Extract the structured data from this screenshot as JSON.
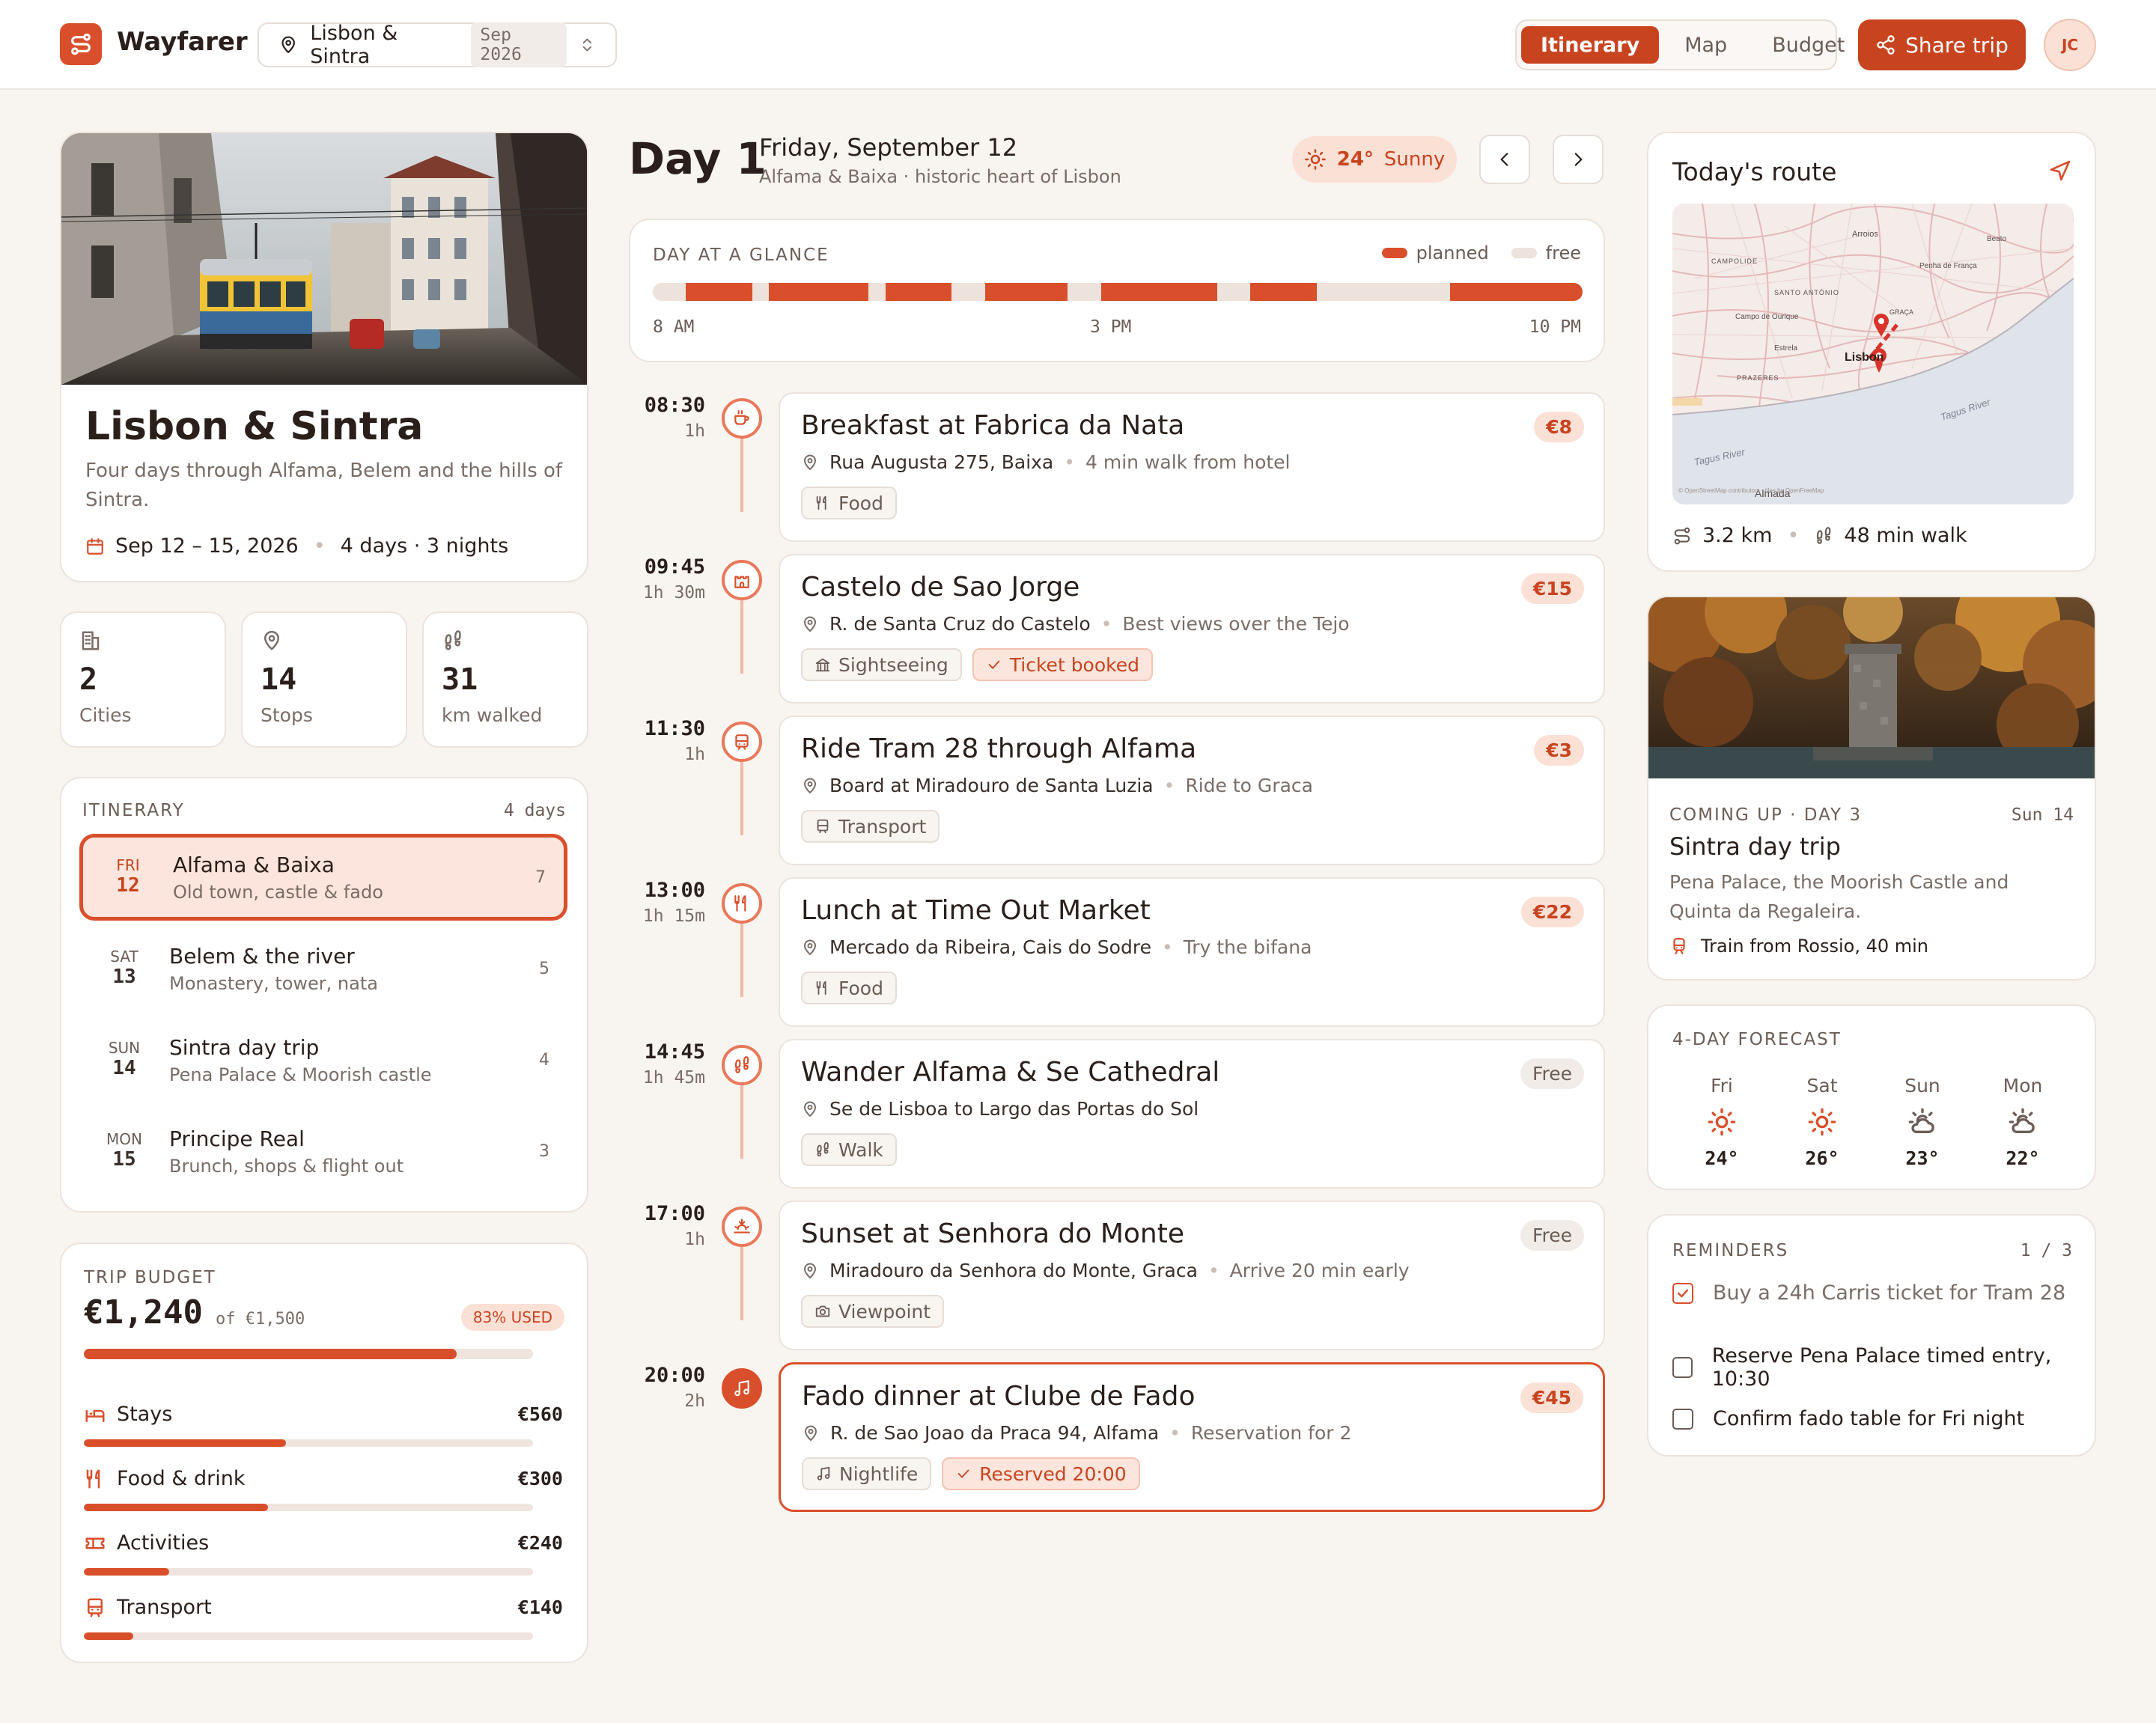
{
  "header": {
    "brand": "Wayfarer",
    "trip_selector": {
      "trip": "Lisbon & Sintra",
      "date": "Sep 2026"
    },
    "tabs": [
      {
        "label": "Itinerary",
        "active": true
      },
      {
        "label": "Map",
        "active": false
      },
      {
        "label": "Budget",
        "active": false
      }
    ],
    "share_label": "Share trip",
    "avatar_initials": "JC"
  },
  "colors": {
    "accent": "#d94f2b",
    "accent_dark": "#c8441f",
    "background": "#f8f4f0"
  },
  "trip": {
    "title": "Lisbon & Sintra",
    "description": "Four days through Alfama, Belem and the hills of Sintra.",
    "dates": "Sep 12 – 15, 2026",
    "duration": "4 days · 3 nights"
  },
  "stats": [
    {
      "icon": "building-icon",
      "value": "2",
      "label": "Cities"
    },
    {
      "icon": "pin-icon",
      "value": "14",
      "label": "Stops"
    },
    {
      "icon": "footprints-icon",
      "value": "31",
      "label": "km walked"
    }
  ],
  "itinerary": {
    "title": "ITINERARY",
    "count": "4 days",
    "days": [
      {
        "dow": "FRI",
        "date": "12",
        "title": "Alfama & Baixa",
        "subtitle": "Old town, castle & fado",
        "stops": "7",
        "active": true
      },
      {
        "dow": "SAT",
        "date": "13",
        "title": "Belem & the river",
        "subtitle": "Monastery, tower, nata",
        "stops": "5",
        "active": false
      },
      {
        "dow": "SUN",
        "date": "14",
        "title": "Sintra day trip",
        "subtitle": "Pena Palace & Moorish castle",
        "stops": "4",
        "active": false
      },
      {
        "dow": "MON",
        "date": "15",
        "title": "Principe Real",
        "subtitle": "Brunch, shops & flight out",
        "stops": "3",
        "active": false
      }
    ]
  },
  "budget": {
    "title": "TRIP BUDGET",
    "spent": "€1,240",
    "total": "of €1,500",
    "used_badge": "83% USED",
    "used_fraction": 0.83,
    "categories": [
      {
        "icon": "bed-icon",
        "label": "Stays",
        "amount": "€560",
        "fraction": 0.45
      },
      {
        "icon": "utensils-icon",
        "label": "Food & drink",
        "amount": "€300",
        "fraction": 0.41
      },
      {
        "icon": "ticket-icon",
        "label": "Activities",
        "amount": "€240",
        "fraction": 0.19
      },
      {
        "icon": "bus-icon",
        "label": "Transport",
        "amount": "€140",
        "fraction": 0.11
      }
    ]
  },
  "day": {
    "label": "Day 1",
    "date": "Friday, September 12",
    "subtitle": "Alfama & Baixa · historic heart of Lisbon",
    "weather": {
      "temp": "24°",
      "condition": "Sunny"
    },
    "glance": {
      "title": "DAY AT A GLANCE",
      "legend_planned": "planned",
      "legend_free": "free",
      "start_label": "8 AM",
      "mid_label": "3 PM",
      "end_label": "10 PM",
      "planned_segments": [
        [
          8.5,
          9.5
        ],
        [
          9.75,
          11.25
        ],
        [
          11.5,
          12.5
        ],
        [
          13.0,
          14.25
        ],
        [
          14.75,
          16.5
        ],
        [
          17.0,
          18.0
        ],
        [
          20.0,
          22.0
        ]
      ]
    }
  },
  "events": [
    {
      "time": "08:30",
      "duration": "1h",
      "icon": "coffee-icon",
      "title": "Breakfast at Fabrica da Nata",
      "price": "€8",
      "free": false,
      "location": "Rua Augusta 275, Baixa",
      "note": "4 min walk from hotel",
      "tags": [
        {
          "icon": "utensils-icon",
          "label": "Food"
        }
      ],
      "highlight": false
    },
    {
      "time": "09:45",
      "duration": "1h 30m",
      "icon": "castle-icon",
      "title": "Castelo de Sao Jorge",
      "price": "€15",
      "free": false,
      "location": "R. de Santa Cruz do Castelo",
      "note": "Best views over the Tejo",
      "tags": [
        {
          "icon": "landmark-icon",
          "label": "Sightseeing"
        },
        {
          "icon": "check-icon",
          "label": "Ticket booked",
          "ok": true
        }
      ],
      "highlight": false
    },
    {
      "time": "11:30",
      "duration": "1h",
      "icon": "tram-icon",
      "title": "Ride Tram 28 through Alfama",
      "price": "€3",
      "free": false,
      "location": "Board at Miradouro de Santa Luzia",
      "note": "Ride to Graca",
      "tags": [
        {
          "icon": "bus-icon",
          "label": "Transport"
        }
      ],
      "highlight": false
    },
    {
      "time": "13:00",
      "duration": "1h 15m",
      "icon": "utensils-icon",
      "title": "Lunch at Time Out Market",
      "price": "€22",
      "free": false,
      "location": "Mercado da Ribeira, Cais do Sodre",
      "note": "Try the bifana",
      "tags": [
        {
          "icon": "utensils-icon",
          "label": "Food"
        }
      ],
      "highlight": false
    },
    {
      "time": "14:45",
      "duration": "1h 45m",
      "icon": "footprints-icon",
      "title": "Wander Alfama & Se Cathedral",
      "price": "Free",
      "free": true,
      "location": "Se de Lisboa to Largo das Portas do Sol",
      "note": "",
      "tags": [
        {
          "icon": "footprints-icon",
          "label": "Walk"
        }
      ],
      "highlight": false
    },
    {
      "time": "17:00",
      "duration": "1h",
      "icon": "sunset-icon",
      "title": "Sunset at Senhora do Monte",
      "price": "Free",
      "free": true,
      "location": "Miradouro da Senhora do Monte, Graca",
      "note": "Arrive 20 min early",
      "tags": [
        {
          "icon": "camera-icon",
          "label": "Viewpoint"
        }
      ],
      "highlight": false
    },
    {
      "time": "20:00",
      "duration": "2h",
      "icon": "music-icon",
      "title": "Fado dinner at Clube de Fado",
      "price": "€45",
      "free": false,
      "location": "R. de Sao Joao da Praca 94, Alfama",
      "note": "Reservation for 2",
      "tags": [
        {
          "icon": "music-icon",
          "label": "Nightlife"
        },
        {
          "icon": "check-icon",
          "label": "Reserved 20:00",
          "ok": true
        }
      ],
      "highlight": true
    }
  ],
  "route": {
    "title": "Today's route",
    "distance": "3.2 km",
    "walk": "48 min walk",
    "map_labels": {
      "arroios": "Arroios",
      "beato": "Beato",
      "penha": "Penha de França",
      "campolide": "CAMPOLIDE",
      "santo_antonio": "SANTO ANTÓNIO",
      "campo_ourique": "Campo de Ourique",
      "estrela": "Estrela",
      "graca": "GRAÇA",
      "lisbon": "Lisbon",
      "prazeres": "PRAZERES",
      "tagus1": "Tagus River",
      "tagus2": "Tagus River",
      "almada": "Almada",
      "attribution": "© OpenStreetMap contributors · tiles by OpenFreeMap"
    }
  },
  "coming_up": {
    "label": "COMING UP · DAY 3",
    "date": "Sun 14",
    "title": "Sintra day trip",
    "description": "Pena Palace, the Moorish Castle and Quinta da Regaleira.",
    "transport": "Train from Rossio, 40 min"
  },
  "forecast": {
    "title": "4-DAY FORECAST",
    "days": [
      {
        "day": "Fri",
        "icon": "sun-icon",
        "temp": "24°"
      },
      {
        "day": "Sat",
        "icon": "sun-icon",
        "temp": "26°"
      },
      {
        "day": "Sun",
        "icon": "partly-cloudy-icon",
        "temp": "23°"
      },
      {
        "day": "Mon",
        "icon": "partly-cloudy-icon",
        "temp": "22°"
      }
    ]
  },
  "reminders": {
    "title": "REMINDERS",
    "count": "1 / 3",
    "items": [
      {
        "label": "Buy a 24h Carris ticket for Tram 28",
        "done": true
      },
      {
        "label": "Reserve Pena Palace timed entry, 10:30",
        "done": false
      },
      {
        "label": "Confirm fado table for Fri night",
        "done": false
      }
    ]
  }
}
